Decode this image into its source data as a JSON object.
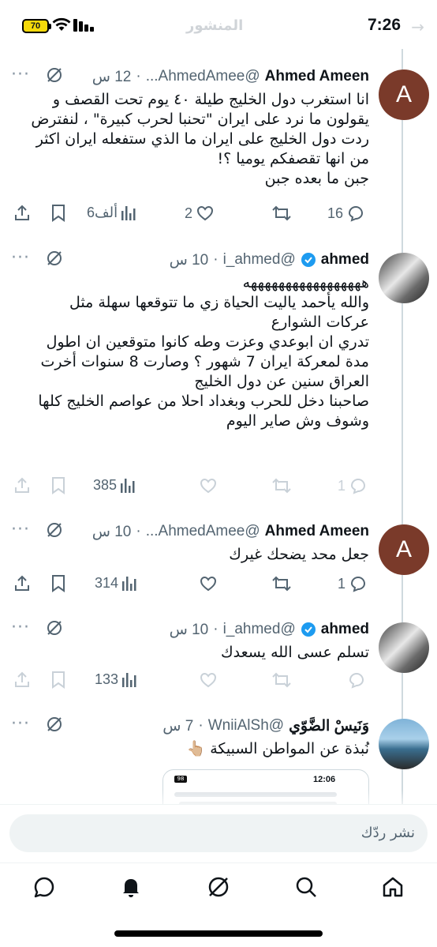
{
  "status_bar": {
    "time": "7:26",
    "battery": "70"
  },
  "faded_header": {
    "title": "المنشور"
  },
  "tweets": [
    {
      "name": "Ahmed Ameen",
      "handle": "@AhmedAmee...",
      "time": "12 س",
      "avatar_letter": "A",
      "verified": false,
      "text": "انا استغرب دول الخليج طيلة ٤٠ يوم تحت القصف و يقولون ما نرد على ايران \"تحنبا لحرب كبيرة\" ، لنفترض ردت دول الخليج على ايران ما الذي ستفعله ايران اكثر من انها تقصفكم يوميا ؟!\nجبن ما بعده جبن",
      "replies": "16",
      "retweets": "",
      "likes": "2",
      "views": "6ألف"
    },
    {
      "name": "ahmed",
      "handle": "@i_ahmed",
      "time": "10 س",
      "verified": true,
      "text": "هههههههههههههههههه\nوالله يأحمد ياليت الحياة زي ما تتوقعها سهلة مثل عركات الشوارع\nتدري ان ابوعدي وعزت وطه كانوا متوقعين ان اطول مدة لمعركة ايران 7 شهور ؟ وصارت 8 سنوات أخرت العراق سنين عن دول الخليج\nصاحبنا دخل للحرب وبغداد احلا من عواصم الخليج كلها\nوشوف وش صاير اليوم",
      "replies": "1",
      "retweets": "",
      "likes": "",
      "views": "385"
    },
    {
      "name": "Ahmed Ameen",
      "handle": "@AhmedAmee...",
      "time": "10 س",
      "avatar_letter": "A",
      "verified": false,
      "text": "جعل محد يضحك غيرك",
      "replies": "1",
      "retweets": "",
      "likes": "",
      "views": "314"
    },
    {
      "name": "ahmed",
      "handle": "@i_ahmed",
      "time": "10 س",
      "verified": true,
      "text": "تسلم عسى الله يسعدك",
      "replies": "",
      "retweets": "",
      "likes": "",
      "views": "133"
    },
    {
      "name": "وَنَيسْ الضَّوّي",
      "handle": "@WniiAlSh",
      "time": "7 س",
      "verified": false,
      "text": "نُبذة عن المواطن السبيكة 👆🏼",
      "embed": {
        "time": "12:06",
        "battery": "98"
      }
    }
  ],
  "reply_bar": {
    "placeholder": "نشر ردّك"
  },
  "bottom_nav": [
    "home-icon",
    "search-icon",
    "grok-icon",
    "notifications-icon",
    "messages-icon"
  ],
  "colors": {
    "accent": "#1d9bf0",
    "muted": "#536471",
    "avatar_a": "#7a3a2a"
  }
}
